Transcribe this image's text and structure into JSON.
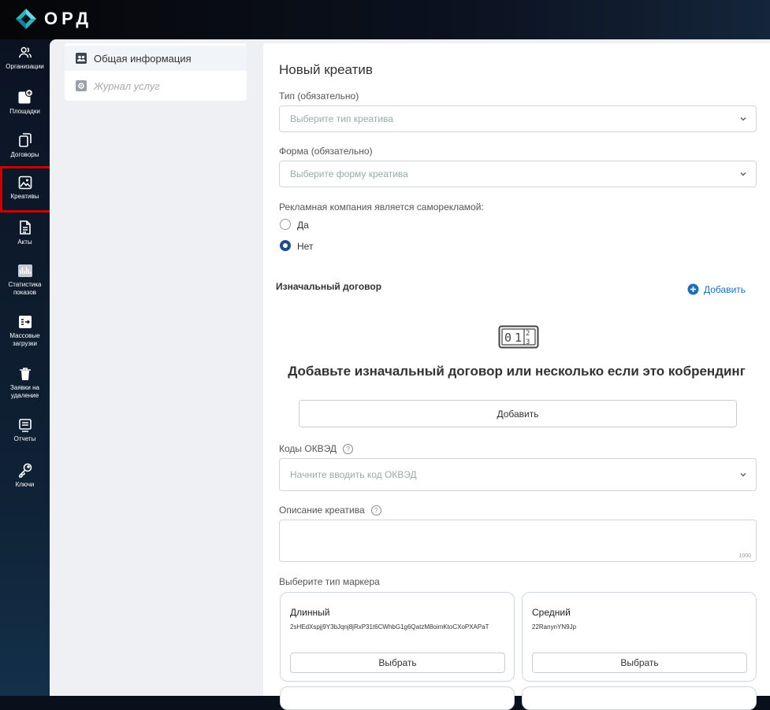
{
  "app": {
    "name": "ОРД",
    "brand_color": "#1e6fb8"
  },
  "sidebar": {
    "items": [
      {
        "label": "Организации",
        "icon": "users-icon"
      },
      {
        "label": "Площадки",
        "icon": "add-square-icon"
      },
      {
        "label": "Договоры",
        "icon": "copy-icon"
      },
      {
        "label": "Креативы",
        "icon": "image-icon",
        "active": true
      },
      {
        "label": "Акты",
        "icon": "document-icon"
      },
      {
        "label": "Статистика показов",
        "icon": "stats-icon"
      },
      {
        "label": "Массовые загрузки",
        "icon": "upload-icon"
      },
      {
        "label": "Заявки на удаление",
        "icon": "trash-icon"
      },
      {
        "label": "Отчеты",
        "icon": "report-icon"
      },
      {
        "label": "Ключи",
        "icon": "key-icon"
      }
    ]
  },
  "leftmenu": {
    "general": "Общая информация",
    "journal": "Журнал услуг"
  },
  "form": {
    "title": "Новый креатив",
    "type_label": "Тип (обязательно)",
    "type_placeholder": "Выберите тип креатива",
    "form_label": "Форма (обязательно)",
    "form_placeholder": "Выберите форму креатива",
    "self_ad_label": "Рекламная компания является саморекламой:",
    "yes": "Да",
    "no": "Нет",
    "self_ad_value": "Нет",
    "contract_title": "Изначальный договор",
    "add_link": "Добавить",
    "empty_text": "Добавьте изначальный договор или несколько если это кобрендинг",
    "add_button": "Добавить",
    "okved_label": "Коды ОКВЭД",
    "okved_placeholder": "Начните вводить код ОКВЭД",
    "desc_label": "Описание креатива",
    "desc_counter": "1000",
    "marker_label": "Выберите тип маркера",
    "markers": [
      {
        "title": "Длинный",
        "code": "2sHEdXspjj9Y3bJqnj8jRxP31t6CWhbG1g6QatzM8oimKtoCXoPXAPaT",
        "button": "Выбрать"
      },
      {
        "title": "Средний",
        "code": "22RanynYN9Jp",
        "button": "Выбрать"
      }
    ]
  }
}
